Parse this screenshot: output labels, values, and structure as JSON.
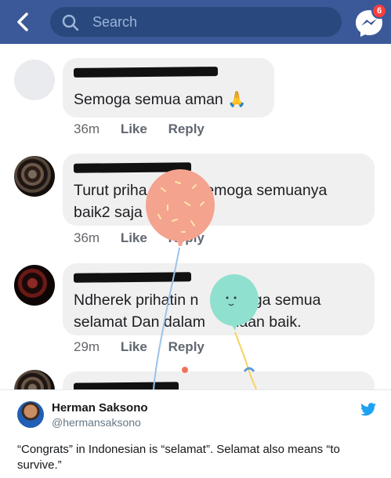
{
  "header": {
    "search_placeholder": "Search",
    "notification_count": "6"
  },
  "comments": [
    {
      "line1": "Semoga semua aman 🙏",
      "line2": "",
      "time": "36m",
      "like": "Like",
      "reply": "Reply"
    },
    {
      "line1": "Turut priha            semoga semuanya",
      "line2": "baik2 saja",
      "time": "36m",
      "like": "Like",
      "reply": "Reply"
    },
    {
      "line1": "Ndherek prihatin n      emoga semua",
      "line2": "selamat Dan dalam      daan baik.",
      "time": "29m",
      "like": "Like",
      "reply": "Reply"
    }
  ],
  "tweet": {
    "name": "Herman Saksono",
    "handle": "@hermansaksono",
    "text": "“Congrats” in Indonesian is “selamat”. Selamat also means “to survive.”"
  },
  "colors": {
    "facebook_blue": "#3b5998",
    "twitter_blue": "#1da1f2",
    "balloon_pink": "#f4a38f",
    "balloon_mint": "#8fe0cf"
  }
}
